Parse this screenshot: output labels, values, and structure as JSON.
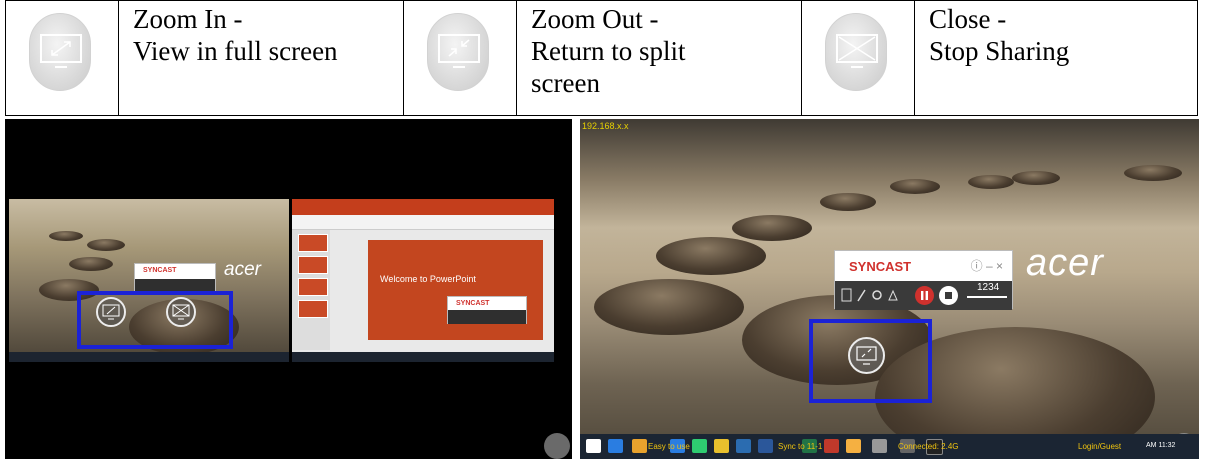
{
  "legend": {
    "zoom_in": {
      "title": "Zoom In -",
      "desc": "View in full screen",
      "icon": "expand-arrows-icon"
    },
    "zoom_out": {
      "title": "Zoom Out -",
      "desc_line1": "Return to split",
      "desc_line2": "screen",
      "icon": "collapse-arrows-icon"
    },
    "close": {
      "title": "Close -",
      "desc": "Stop Sharing",
      "icon": "close-x-icon"
    }
  },
  "left_screen": {
    "ppt_slide_title": "Welcome to PowerPoint",
    "syncast_label": "SYNCAST",
    "acer_logo": "acer",
    "ppt_syncast_label": "SYNCAST"
  },
  "right_screen": {
    "top_left_tag": "192.168.x.x",
    "syncast_label": "SYNCAST",
    "syncast_controls": "ⓘ – ×",
    "volume_value": "1234",
    "acer_logo": "acer",
    "taskbar_texts": [
      "Easy to use",
      "Sync to 11-1",
      "Connected: 2.4G",
      "Login/Guest"
    ],
    "taskbar_time": "AM 11:32"
  },
  "colors": {
    "highlight": "#1b22d6",
    "syncast_red": "#d0312d",
    "ppt_orange": "#c3461f"
  }
}
